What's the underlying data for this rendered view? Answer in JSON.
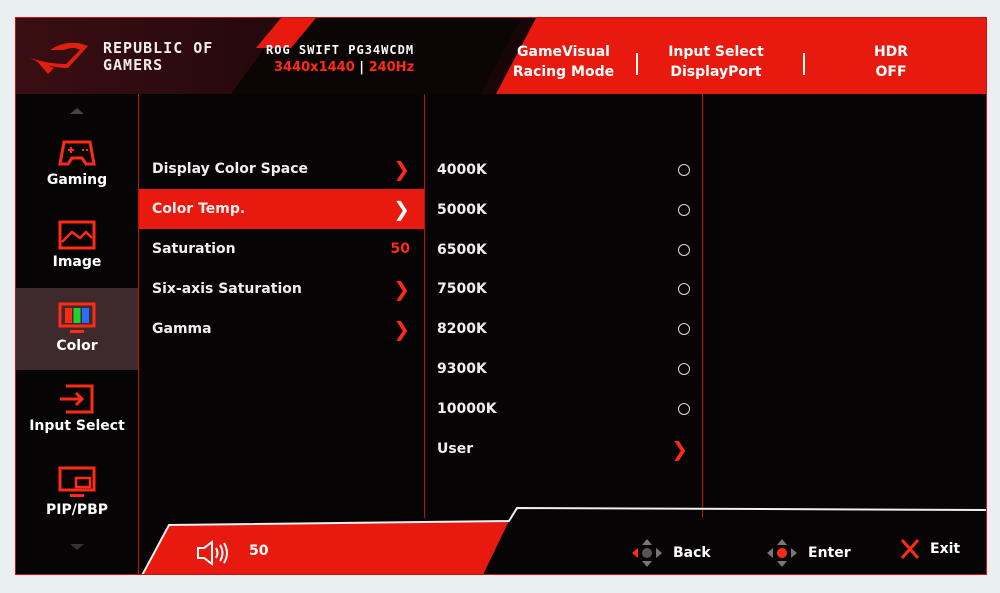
{
  "header": {
    "brand": "REPUBLIC OF GAMERS",
    "brand_line1": "REPUBLIC OF",
    "brand_line2": "GAMERS",
    "model": "ROG SWIFT PG34WCDM",
    "resolution": "3440x1440",
    "refresh": "240Hz",
    "game_visual_label": "GameVisual",
    "game_visual_value": "Racing Mode",
    "input_label": "Input Select",
    "input_value": "DisplayPort",
    "hdr_label": "HDR",
    "hdr_value": "OFF"
  },
  "sidebar": {
    "items": [
      {
        "label": "Gaming",
        "icon": "gamepad-icon"
      },
      {
        "label": "Image",
        "icon": "image-icon"
      },
      {
        "label": "Color",
        "icon": "color-monitor-icon",
        "active": true
      },
      {
        "label": "Input Select",
        "icon": "input-icon"
      },
      {
        "label": "PIP/PBP",
        "icon": "pip-icon"
      }
    ]
  },
  "menu": {
    "items": [
      {
        "label": "Display Color Space",
        "indicator": "chevron"
      },
      {
        "label": "Color Temp.",
        "indicator": "chevron",
        "active": true
      },
      {
        "label": "Saturation",
        "value": "50"
      },
      {
        "label": "Six-axis Saturation",
        "indicator": "chevron"
      },
      {
        "label": "Gamma",
        "indicator": "chevron"
      }
    ]
  },
  "options": {
    "items": [
      {
        "label": "4000K",
        "type": "radio"
      },
      {
        "label": "5000K",
        "type": "radio"
      },
      {
        "label": "6500K",
        "type": "radio"
      },
      {
        "label": "7500K",
        "type": "radio"
      },
      {
        "label": "8200K",
        "type": "radio"
      },
      {
        "label": "9300K",
        "type": "radio"
      },
      {
        "label": "10000K",
        "type": "radio"
      },
      {
        "label": "User",
        "type": "chevron"
      }
    ]
  },
  "footer": {
    "volume": "50",
    "back_label": "Back",
    "enter_label": "Enter",
    "exit_label": "Exit"
  },
  "colors": {
    "accent": "#e81a0f",
    "background": "#060404",
    "active_sidebar": "#3e2a2c"
  }
}
